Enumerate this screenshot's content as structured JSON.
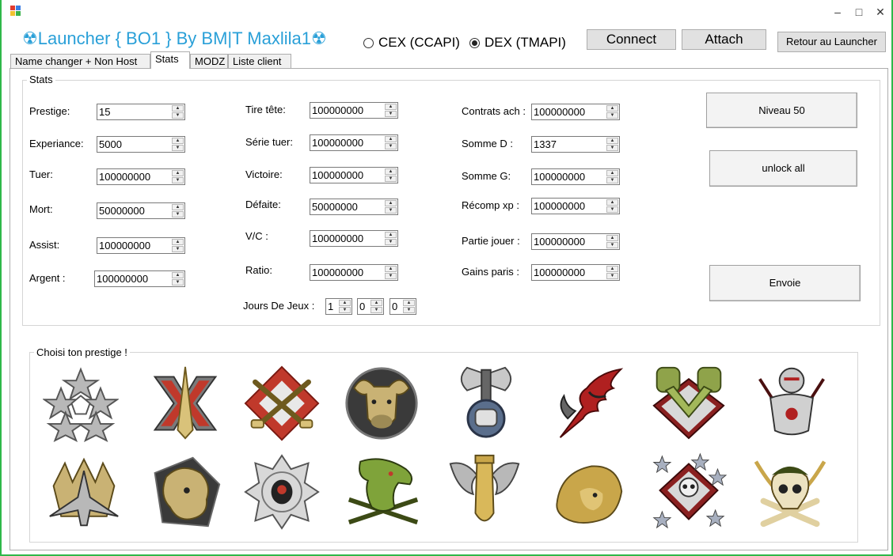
{
  "window": {
    "title_text": "☢Launcher { BO1 }  By BM|T Maxlila1☢",
    "minimize": "–",
    "maximize": "□",
    "close": "✕"
  },
  "api": {
    "cex_label": "CEX (CCAPI)",
    "dex_label": "DEX (TMAPI)",
    "selected": "DEX (TMAPI)"
  },
  "buttons": {
    "connect": "Connect",
    "attach": "Attach",
    "retour": "Retour au Launcher",
    "niveau50": "Niveau 50",
    "unlock_all": "unlock all",
    "envoie": "Envoie"
  },
  "tabs": [
    {
      "label": "Name changer + Non Host"
    },
    {
      "label": "Stats"
    },
    {
      "label": "MODZ"
    },
    {
      "label": "Liste client"
    }
  ],
  "stats": {
    "group_title": "Stats",
    "col1": [
      {
        "label": "Prestige:",
        "value": "15"
      },
      {
        "label": "Experiance:",
        "value": "5000"
      },
      {
        "label": "Tuer:",
        "value": "100000000"
      },
      {
        "label": "Mort:",
        "value": "50000000"
      },
      {
        "label": "Assist:",
        "value": "100000000"
      },
      {
        "label": "Argent :",
        "value": "100000000"
      }
    ],
    "col2": [
      {
        "label": "Tire tête:",
        "value": "100000000"
      },
      {
        "label": "Série tuer:",
        "value": "100000000"
      },
      {
        "label": "Victoire:",
        "value": "100000000"
      },
      {
        "label": "Défaite:",
        "value": "50000000"
      },
      {
        "label": "V/C :",
        "value": "100000000"
      },
      {
        "label": "Ratio:",
        "value": "100000000"
      }
    ],
    "col3": [
      {
        "label": "Contrats ach :",
        "value": "100000000"
      },
      {
        "label": "Somme D :",
        "value": "1337"
      },
      {
        "label": "Somme G:",
        "value": "100000000"
      },
      {
        "label": "Récomp  xp :",
        "value": "100000000"
      },
      {
        "label": "Partie jouer :",
        "value": "100000000"
      },
      {
        "label": "Gains paris :",
        "value": "100000000"
      }
    ],
    "jours": {
      "label": "Jours De Jeux :",
      "d": "1",
      "h": "0",
      "m": "0"
    }
  },
  "prestige": {
    "group_title": "Choisi ton prestige !",
    "emblems": [
      {
        "icon": "five-stars-emblem-icon"
      },
      {
        "icon": "spike-x-emblem-icon"
      },
      {
        "icon": "crossed-pistols-emblem-icon"
      },
      {
        "icon": "bull-head-emblem-icon"
      },
      {
        "icon": "axe-fist-emblem-icon"
      },
      {
        "icon": "red-claw-emblem-icon"
      },
      {
        "icon": "clasped-fists-emblem-icon"
      },
      {
        "icon": "knight-armor-emblem-icon"
      },
      {
        "icon": "jet-crown-emblem-icon"
      },
      {
        "icon": "lion-shield-emblem-icon"
      },
      {
        "icon": "spider-web-emblem-icon"
      },
      {
        "icon": "dragon-knives-emblem-icon"
      },
      {
        "icon": "winged-bomb-emblem-icon"
      },
      {
        "icon": "lion-head-emblem-icon"
      },
      {
        "icon": "skull-stars-emblem-icon"
      },
      {
        "icon": "skull-crossbones-emblem-icon"
      }
    ]
  },
  "colors": {
    "title_accent": "#2aa0d8",
    "window_border": "#2fb84a"
  }
}
